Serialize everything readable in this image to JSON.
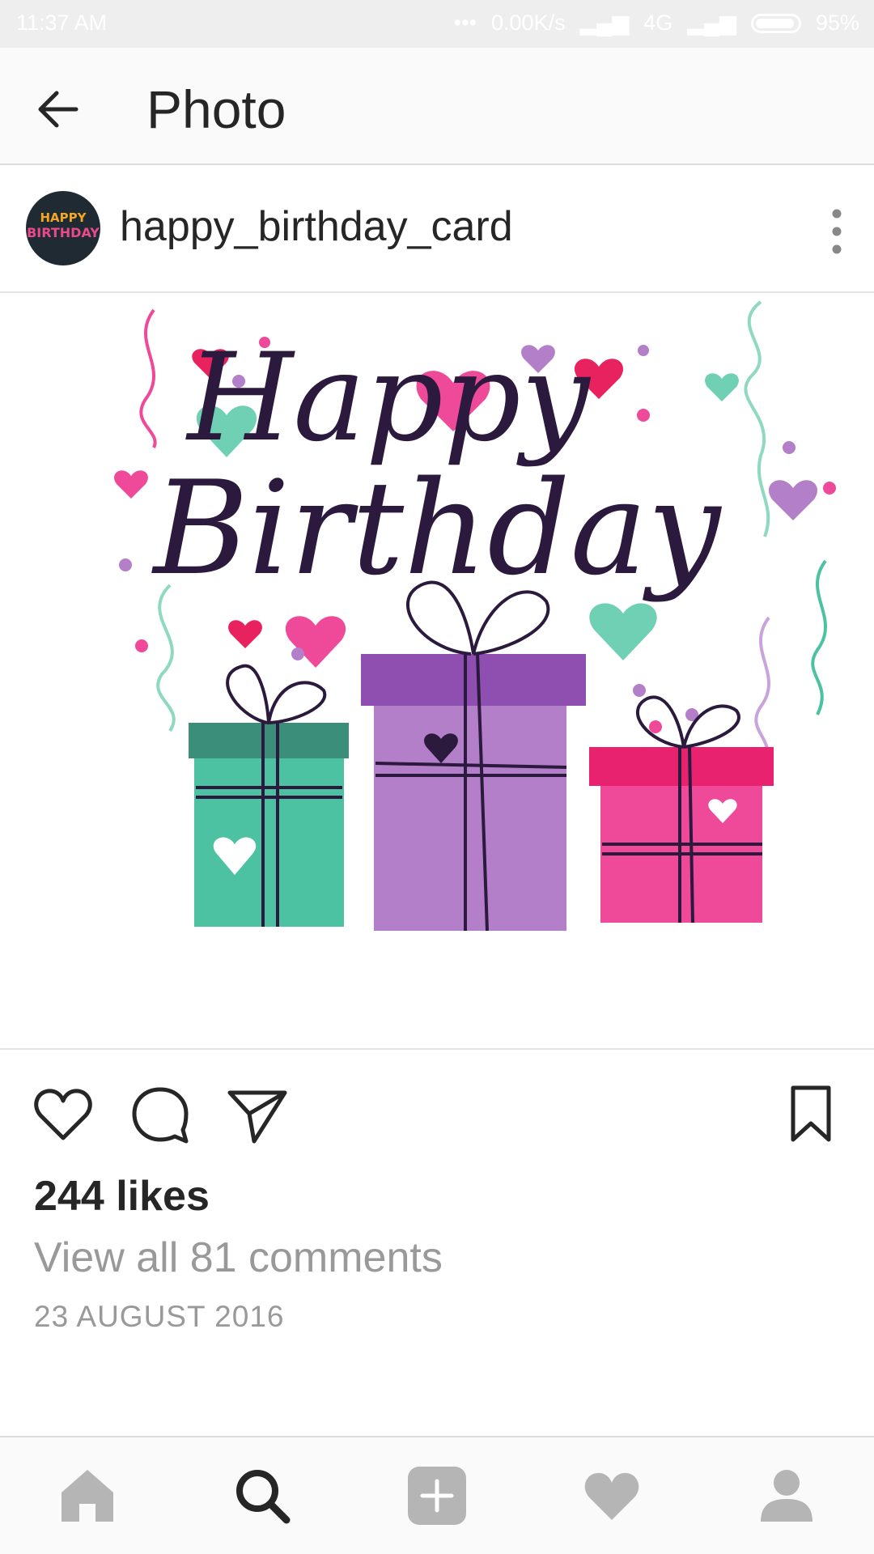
{
  "status_bar": {
    "time": "11:37 AM",
    "network_speed": "0.00K/s",
    "network_type": "4G",
    "battery": "95%"
  },
  "toolbar": {
    "title": "Photo"
  },
  "post": {
    "username": "happy_birthday_card",
    "avatar_text": [
      "HAPPY",
      "BIRTHDAY"
    ],
    "image_text": [
      "Happy",
      "Birthday"
    ],
    "likes": "244 likes",
    "comments_link": "View all 81 comments",
    "date": "23 AUGUST 2016"
  },
  "icons": {
    "back": "back-arrow-icon",
    "more": "more-vertical-icon",
    "like": "heart-outline-icon",
    "comment": "comment-icon",
    "share": "send-icon",
    "save": "bookmark-icon",
    "nav": [
      "home-icon",
      "search-icon",
      "add-icon",
      "activity-heart-icon",
      "profile-icon"
    ]
  },
  "colors": {
    "teal": "#4cc2a2",
    "purple": "#b37fc8",
    "pink": "#ef4a99",
    "ink": "#2b1a3d"
  }
}
